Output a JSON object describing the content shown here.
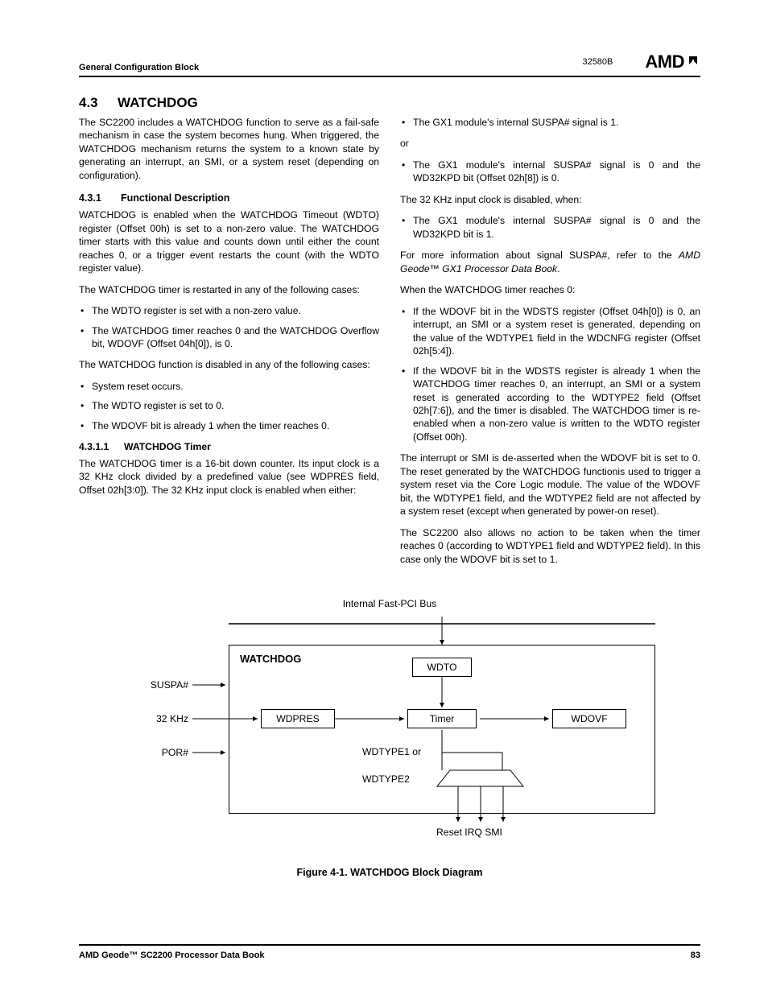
{
  "header": {
    "section": "General Configuration Block",
    "docnum": "32580B",
    "logo": "AMD"
  },
  "title": {
    "num": "4.3",
    "text": "WATCHDOG"
  },
  "col1": {
    "intro": "The SC2200 includes a WATCHDOG function to serve as a fail-safe mechanism in case the system becomes hung. When triggered, the WATCHDOG mechanism returns the system to a known state by generating an interrupt, an SMI, or a system reset (depending on configuration).",
    "sub431_num": "4.3.1",
    "sub431_title": "Functional Description",
    "sub431_p1": "WATCHDOG is enabled when the WATCHDOG Timeout (WDTO) register (Offset 00h) is set to a non-zero value. The WATCHDOG timer starts with this value and counts down until either the count reaches 0, or a trigger event restarts the count (with the WDTO register value).",
    "sub431_p2": "The WATCHDOG timer is restarted in any of the following cases:",
    "sub431_b1": "The WDTO register is set with a non-zero value.",
    "sub431_b2": "The WATCHDOG timer reaches 0 and the WATCHDOG Overflow bit, WDOVF (Offset 04h[0]), is 0.",
    "sub431_p3": "The WATCHDOG function is disabled in any of the following cases:",
    "sub431_b3": "System reset occurs.",
    "sub431_b4": "The WDTO register is set to 0.",
    "sub431_b5": "The WDOVF bit is already 1 when the timer reaches 0.",
    "sub4311_num": "4.3.1.1",
    "sub4311_title": "WATCHDOG Timer",
    "sub4311_p1": "The WATCHDOG timer is a 16-bit down counter. Its input clock is a 32 KHz clock divided by a predefined value (see WDPRES field, Offset 02h[3:0]). The 32 KHz input clock is enabled when either:"
  },
  "col2": {
    "b1": "The GX1 module's internal SUSPA# signal is 1.",
    "or": "or",
    "b2": "The GX1 module's internal SUSPA# signal is 0 and the WD32KPD bit (Offset 02h[8]) is 0.",
    "p1": "The 32 KHz input clock is disabled, when:",
    "b3": "The GX1 module's internal SUSPA# signal is 0 and the WD32KPD bit is 1.",
    "p2a": "For more information about signal SUSPA#, refer to the ",
    "p2b": "AMD Geode™ GX1 Processor Data Book",
    "p2c": ".",
    "p3": "When the WATCHDOG timer reaches 0:",
    "b4": "If the WDOVF bit in the WDSTS register (Offset 04h[0]) is 0, an interrupt, an SMI or a system reset is generated, depending on the value of the WDTYPE1 field in the WDCNFG register (Offset 02h[5:4]).",
    "b5": "If the WDOVF bit in the WDSTS register is already 1 when the WATCHDOG timer reaches 0, an interrupt, an SMI or a system reset is generated according to the WDTYPE2 field (Offset 02h[7:6]), and the timer is disabled. The WATCHDOG timer is re-enabled when a non-zero value is written to the WDTO register (Offset 00h).",
    "p4": "The interrupt or SMI is de-asserted when the WDOVF bit is set to 0. The reset generated by the WATCHDOG functionis used to trigger a system reset via the Core Logic module. The value of the WDOVF bit, the WDTYPE1 field, and the WDTYPE2 field are not affected by a system reset (except when generated by power-on reset).",
    "p5": "The SC2200 also allows no action to be taken when the timer reaches 0 (according to WDTYPE1 field and WDTYPE2 field). In this case only the WDOVF bit is set to 1."
  },
  "diagram": {
    "bus": "Internal Fast-PCI Bus",
    "title": "WATCHDOG",
    "suspa": "SUSPA#",
    "khz": "32 KHz",
    "por": "POR#",
    "wdto": "WDTO",
    "wdpres": "WDPRES",
    "timer": "Timer",
    "wdovf": "WDOVF",
    "wdtype": "WDTYPE1 or",
    "wdtype2": "WDTYPE2",
    "outputs": "Reset IRQ SMI",
    "caption": "Figure 4-1.  WATCHDOG Block Diagram"
  },
  "footer": {
    "left": "AMD Geode™ SC2200  Processor Data Book",
    "right": "83"
  }
}
